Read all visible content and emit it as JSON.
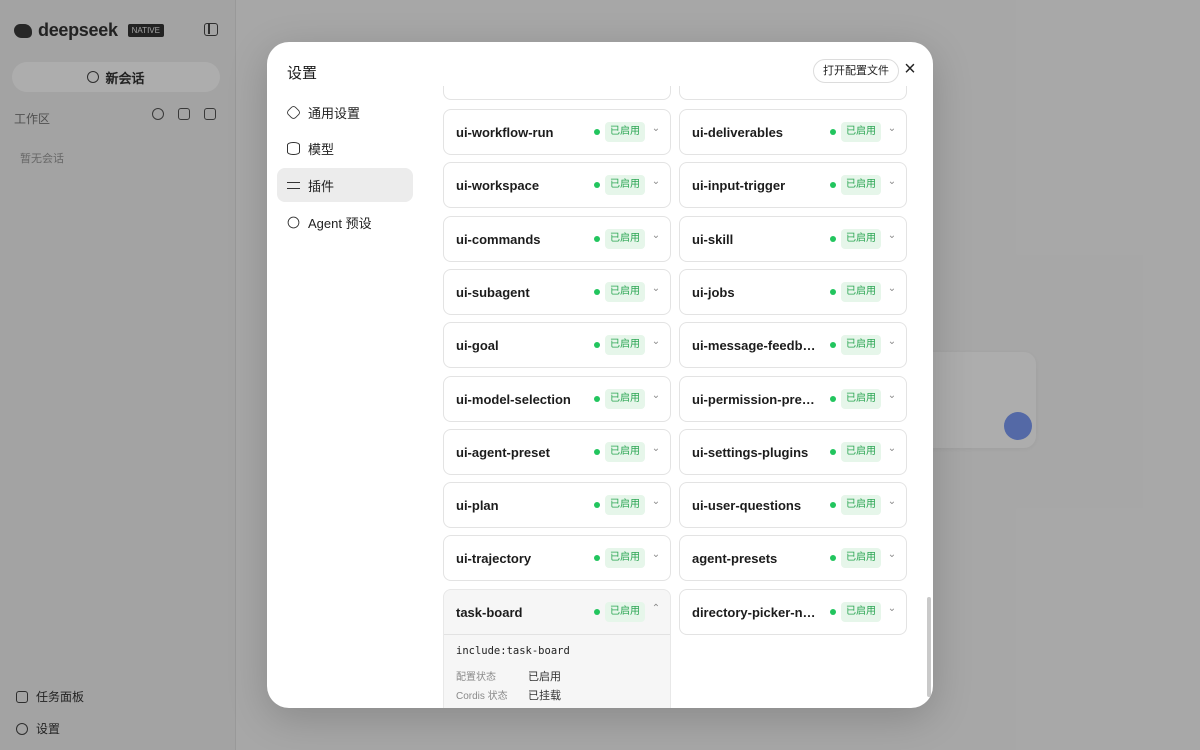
{
  "sidebar": {
    "brand": "deepseek",
    "brand_badge": "NATIVE",
    "new_chat": "新会话",
    "workspace_label": "工作区",
    "empty_text": "暂无会话",
    "task_board": "任务面板",
    "settings": "设置"
  },
  "modal": {
    "title": "设置",
    "open_config": "打开配置文件",
    "close": "×"
  },
  "nav": [
    {
      "label": "通用设置",
      "icon": "gear-icon",
      "active": false
    },
    {
      "label": "模型",
      "icon": "database-icon",
      "active": false
    },
    {
      "label": "插件",
      "icon": "sliders-icon",
      "active": true
    },
    {
      "label": "Agent 预设",
      "icon": "agent-icon",
      "active": false
    }
  ],
  "status_label": "已启用",
  "plugins_left": [
    "ui-workflow-run",
    "ui-workspace",
    "ui-commands",
    "ui-subagent",
    "ui-goal",
    "ui-model-selection",
    "ui-agent-preset",
    "ui-plan",
    "ui-trajectory",
    "task-board"
  ],
  "plugins_right": [
    "ui-deliverables",
    "ui-input-trigger",
    "ui-skill",
    "ui-jobs",
    "ui-message-feedback",
    "ui-permission-presets",
    "ui-settings-plugins",
    "ui-user-questions",
    "agent-presets",
    "directory-picker-nat..."
  ],
  "expanded_detail": {
    "include": "include:task-board",
    "config_status_key": "配置状态",
    "config_status_value": "已启用",
    "cordis_status_key": "Cordis 状态",
    "cordis_status_value": "已挂载"
  },
  "icons": {
    "chevron_down": "⌄",
    "chevron_up": "⌃"
  },
  "colors": {
    "enabled_dot": "#22c55e",
    "enabled_tag_bg": "#e6f6ea",
    "enabled_tag_text": "#2aa552"
  }
}
